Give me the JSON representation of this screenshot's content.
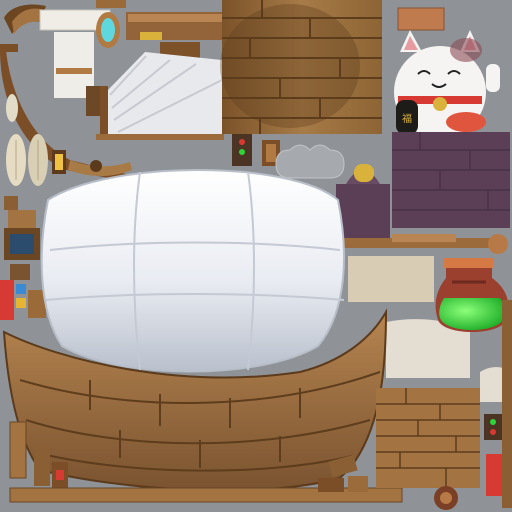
{
  "atlas": {
    "background_color": "#8f9398",
    "wood_light": "#a37645",
    "wood_dark": "#6a4623",
    "wood_mid": "#8a5f34",
    "balloon_light": "#f2f3f7",
    "balloon_shadow": "#c9ced8",
    "sail_color": "#e8e9ec",
    "purple_cloth": "#5b3f56",
    "cat_white": "#f6f4f2",
    "cat_red": "#d63a33",
    "potion_green": "#2fd43a",
    "potion_glass": "#9b3f2e",
    "cork_color": "#b77a47",
    "gold_color": "#d8b23a",
    "cyan_glass": "#5ed7de"
  },
  "items": {
    "balloon_label": "balloon-envelope",
    "hull_label": "boat-hull",
    "cat_label": "lucky-cat",
    "potion_label": "green-potion",
    "wood_panel_label": "wood-planks",
    "purple_bag_label": "purple-cloth",
    "sail_label": "sail-cloth"
  }
}
